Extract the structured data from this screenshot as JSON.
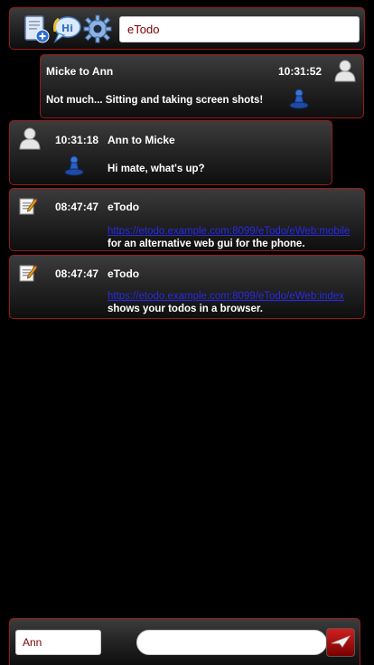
{
  "toolbar": {
    "search_value": "eTodo",
    "icons": [
      "new-task-icon",
      "chat-bubble-icon",
      "gear-icon"
    ]
  },
  "messages": [
    {
      "from": "Micke to Ann",
      "time": "10:31:52",
      "text": "Not much... Sitting and taking screen shots!",
      "icon": "user-avatar-icon",
      "status_icon": "blue-cone-icon"
    },
    {
      "from": "Ann to Micke",
      "time": "10:31:18",
      "text": "Hi mate, what's up?",
      "icon": "user-avatar-icon",
      "status_icon": "blue-cone-icon"
    },
    {
      "from": "eTodo",
      "time": "08:47:47",
      "link": "https://etodo.example.com:8099/eTodo/eWeb:mobile",
      "text": "for an alternative web gui for the phone.",
      "icon": "note-pencil-icon"
    },
    {
      "from": "eTodo",
      "time": "08:47:47",
      "link": "https://etodo.example.com:8099/eTodo/eWeb:index",
      "text": "shows your todos in a browser.",
      "icon": "note-pencil-icon"
    }
  ],
  "bottombar": {
    "to_value": "Ann",
    "message_value": "",
    "send_icon": "paper-plane-icon"
  },
  "colors": {
    "accent_border": "#9a1a1a",
    "input_text": "#7a0000",
    "link": "#2a2ae6",
    "send_button": "#c01818"
  }
}
